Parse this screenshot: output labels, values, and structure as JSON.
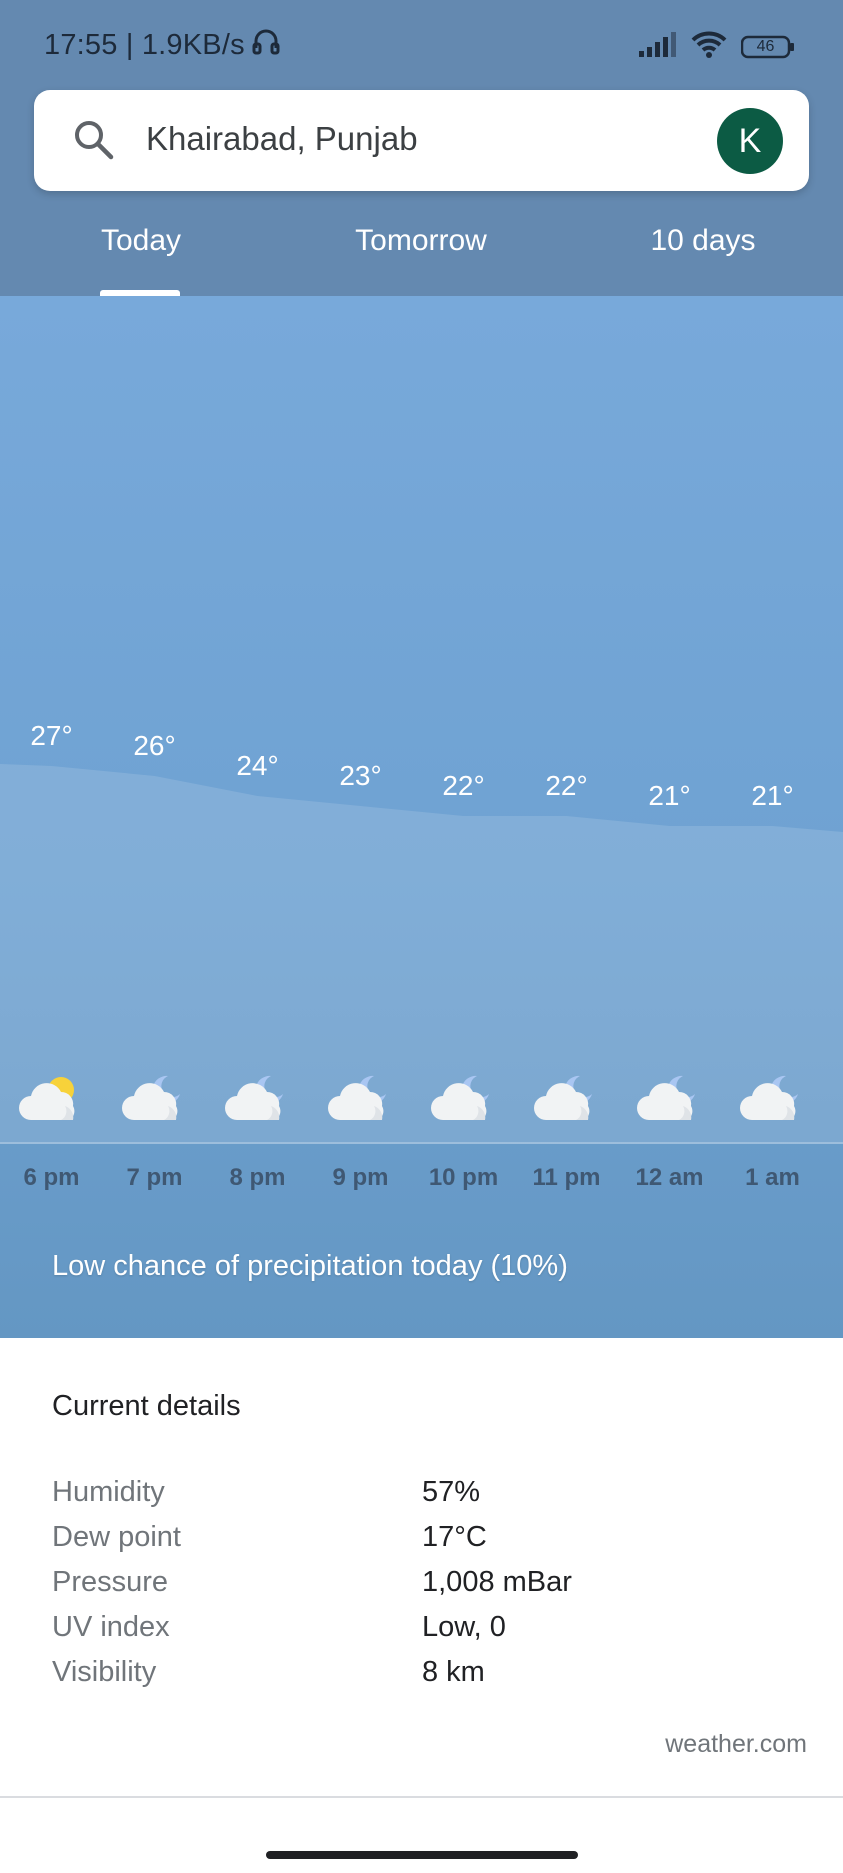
{
  "status_bar": {
    "time_speed": "17:55 | 1.9KB/s",
    "battery": "46",
    "icons": [
      "headphones-icon",
      "signal-icon",
      "wifi-icon",
      "battery-icon"
    ]
  },
  "search": {
    "location": "Khairabad, Punjab",
    "avatar_letter": "K"
  },
  "tabs": [
    {
      "label": "Today",
      "active": true
    },
    {
      "label": "Tomorrow",
      "active": false
    },
    {
      "label": "10 days",
      "active": false
    }
  ],
  "hourly": [
    {
      "time": "6 pm",
      "temp": "27°",
      "icon": "partly-sunny-icon"
    },
    {
      "time": "7 pm",
      "temp": "26°",
      "icon": "partly-cloudy-night-icon"
    },
    {
      "time": "8 pm",
      "temp": "24°",
      "icon": "partly-cloudy-night-icon"
    },
    {
      "time": "9 pm",
      "temp": "23°",
      "icon": "partly-cloudy-night-icon"
    },
    {
      "time": "10 pm",
      "temp": "22°",
      "icon": "partly-cloudy-night-icon"
    },
    {
      "time": "11 pm",
      "temp": "22°",
      "icon": "partly-cloudy-night-icon"
    },
    {
      "time": "12 am",
      "temp": "21°",
      "icon": "partly-cloudy-night-icon"
    },
    {
      "time": "1 am",
      "temp": "21°",
      "icon": "partly-cloudy-night-icon"
    }
  ],
  "precipitation_text": "Low chance of precipitation today (10%)",
  "details": {
    "title": "Current details",
    "rows": [
      {
        "label": "Humidity",
        "value": "57%"
      },
      {
        "label": "Dew point",
        "value": "17°C"
      },
      {
        "label": "Pressure",
        "value": "1,008 mBar"
      },
      {
        "label": "UV index",
        "value": "Low, 0"
      },
      {
        "label": "Visibility",
        "value": "8 km"
      }
    ]
  },
  "source": "weather.com",
  "colors": {
    "header_bg": "#6489b0",
    "sky_top": "#78a9da",
    "sky_bottom": "#6497c3",
    "avatar_bg": "#0c5b44",
    "sun": "#f7d23a",
    "moon": "#a9c6f2"
  }
}
